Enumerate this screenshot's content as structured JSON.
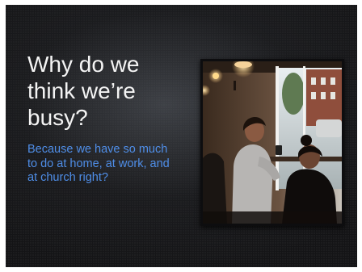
{
  "slide": {
    "title": "Why do we think we’re busy?",
    "subtitle": "Because we have so much to do at home, at work, and at church right?",
    "colors": {
      "background": "#141416",
      "title_text": "#f4f4f4",
      "subtitle_text": "#4f8ee8"
    }
  },
  "photo": {
    "icon": "cafe-photo"
  }
}
